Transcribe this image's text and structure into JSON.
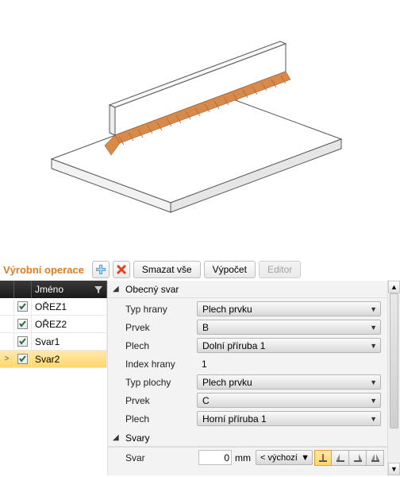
{
  "toolbar": {
    "title": "Výrobní operace",
    "clear_all": "Smazat vše",
    "calculate": "Výpočet",
    "editor": "Editor"
  },
  "grid": {
    "header_name": "Jméno",
    "rows": [
      {
        "name": "OŘEZ1",
        "checked": true,
        "selected": false
      },
      {
        "name": "OŘEZ2",
        "checked": true,
        "selected": false
      },
      {
        "name": "Svar1",
        "checked": true,
        "selected": false
      },
      {
        "name": "Svar2",
        "checked": true,
        "selected": true
      }
    ]
  },
  "sections": {
    "general_weld": {
      "title": "Obecný svar",
      "edge_type_label": "Typ hrany",
      "edge_type_value": "Plech prvku",
      "member_label": "Prvek",
      "member_value": "B",
      "plate_label": "Plech",
      "plate_value": "Dolní příruba 1",
      "edge_index_label": "Index hrany",
      "edge_index_value": "1",
      "surface_type_label": "Typ plochy",
      "surface_type_value": "Plech prvku",
      "member2_label": "Prvek",
      "member2_value": "C",
      "plate2_label": "Plech",
      "plate2_value": "Horní příruba 1"
    },
    "welds": {
      "title": "Svary",
      "weld_label": "Svar",
      "weld_value": "0",
      "weld_unit": "mm",
      "weld_type": "< výchozí"
    }
  },
  "colors": {
    "accent": "#e37a1f",
    "selected_row": "#ffd76e",
    "weld_fill": "#d88a4a"
  }
}
